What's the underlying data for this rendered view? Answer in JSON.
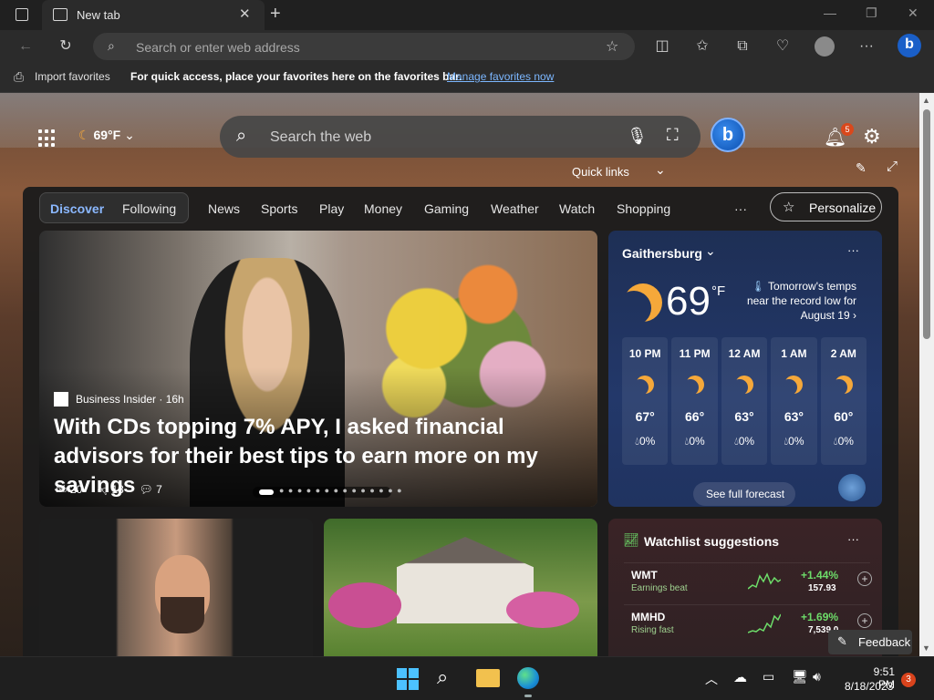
{
  "browser": {
    "tab_title": "New tab",
    "address_placeholder": "Search or enter web address",
    "favorites_bar": {
      "import_label": "Import favorites",
      "message": "For quick access, place your favorites here on the favorites bar.",
      "link": "Manage favorites now"
    }
  },
  "newtab": {
    "weather_mini": "69°F",
    "search_placeholder": "Search the web",
    "quick_links": "Quick links",
    "notification_count": "5",
    "nav": {
      "discover": "Discover",
      "following": "Following",
      "items": [
        "News",
        "Sports",
        "Play",
        "Money",
        "Gaming",
        "Weather",
        "Watch",
        "Shopping"
      ],
      "more": "···",
      "personalize": "Personalize"
    },
    "hero": {
      "source": "Business Insider · 16h",
      "headline": "With CDs topping 7% APY, I asked financial advisors for their best tips to earn more on my savings",
      "likes": "20",
      "dislikes": "18",
      "comments": "7"
    },
    "weather": {
      "location": "Gaithersburg",
      "temp": "69",
      "unit": "°F",
      "note": "Tomorrow's temps near the record low for August 19",
      "hours": [
        {
          "time": "10 PM",
          "temp": "67°",
          "precip": "0%"
        },
        {
          "time": "11 PM",
          "temp": "66°",
          "precip": "0%"
        },
        {
          "time": "12 AM",
          "temp": "63°",
          "precip": "0%"
        },
        {
          "time": "1 AM",
          "temp": "63°",
          "precip": "0%"
        },
        {
          "time": "2 AM",
          "temp": "60°",
          "precip": "0%"
        }
      ],
      "forecast_button": "See full forecast",
      "more": "···"
    },
    "watchlist": {
      "title": "Watchlist suggestions",
      "more": "···",
      "stocks": [
        {
          "symbol": "WMT",
          "sub": "Earnings beat",
          "change": "+1.44%",
          "price": "157.93"
        },
        {
          "symbol": "MMHD",
          "sub": "Rising fast",
          "change": "+1.69%",
          "price": "7,539.0"
        }
      ]
    },
    "feedback": "Feedback"
  },
  "taskbar": {
    "time": "9:51 PM",
    "date": "8/18/2023",
    "badge": "3"
  },
  "colors": {
    "accent": "#7cb7ff",
    "positive": "#6ddc69",
    "badge": "#d9481c"
  }
}
